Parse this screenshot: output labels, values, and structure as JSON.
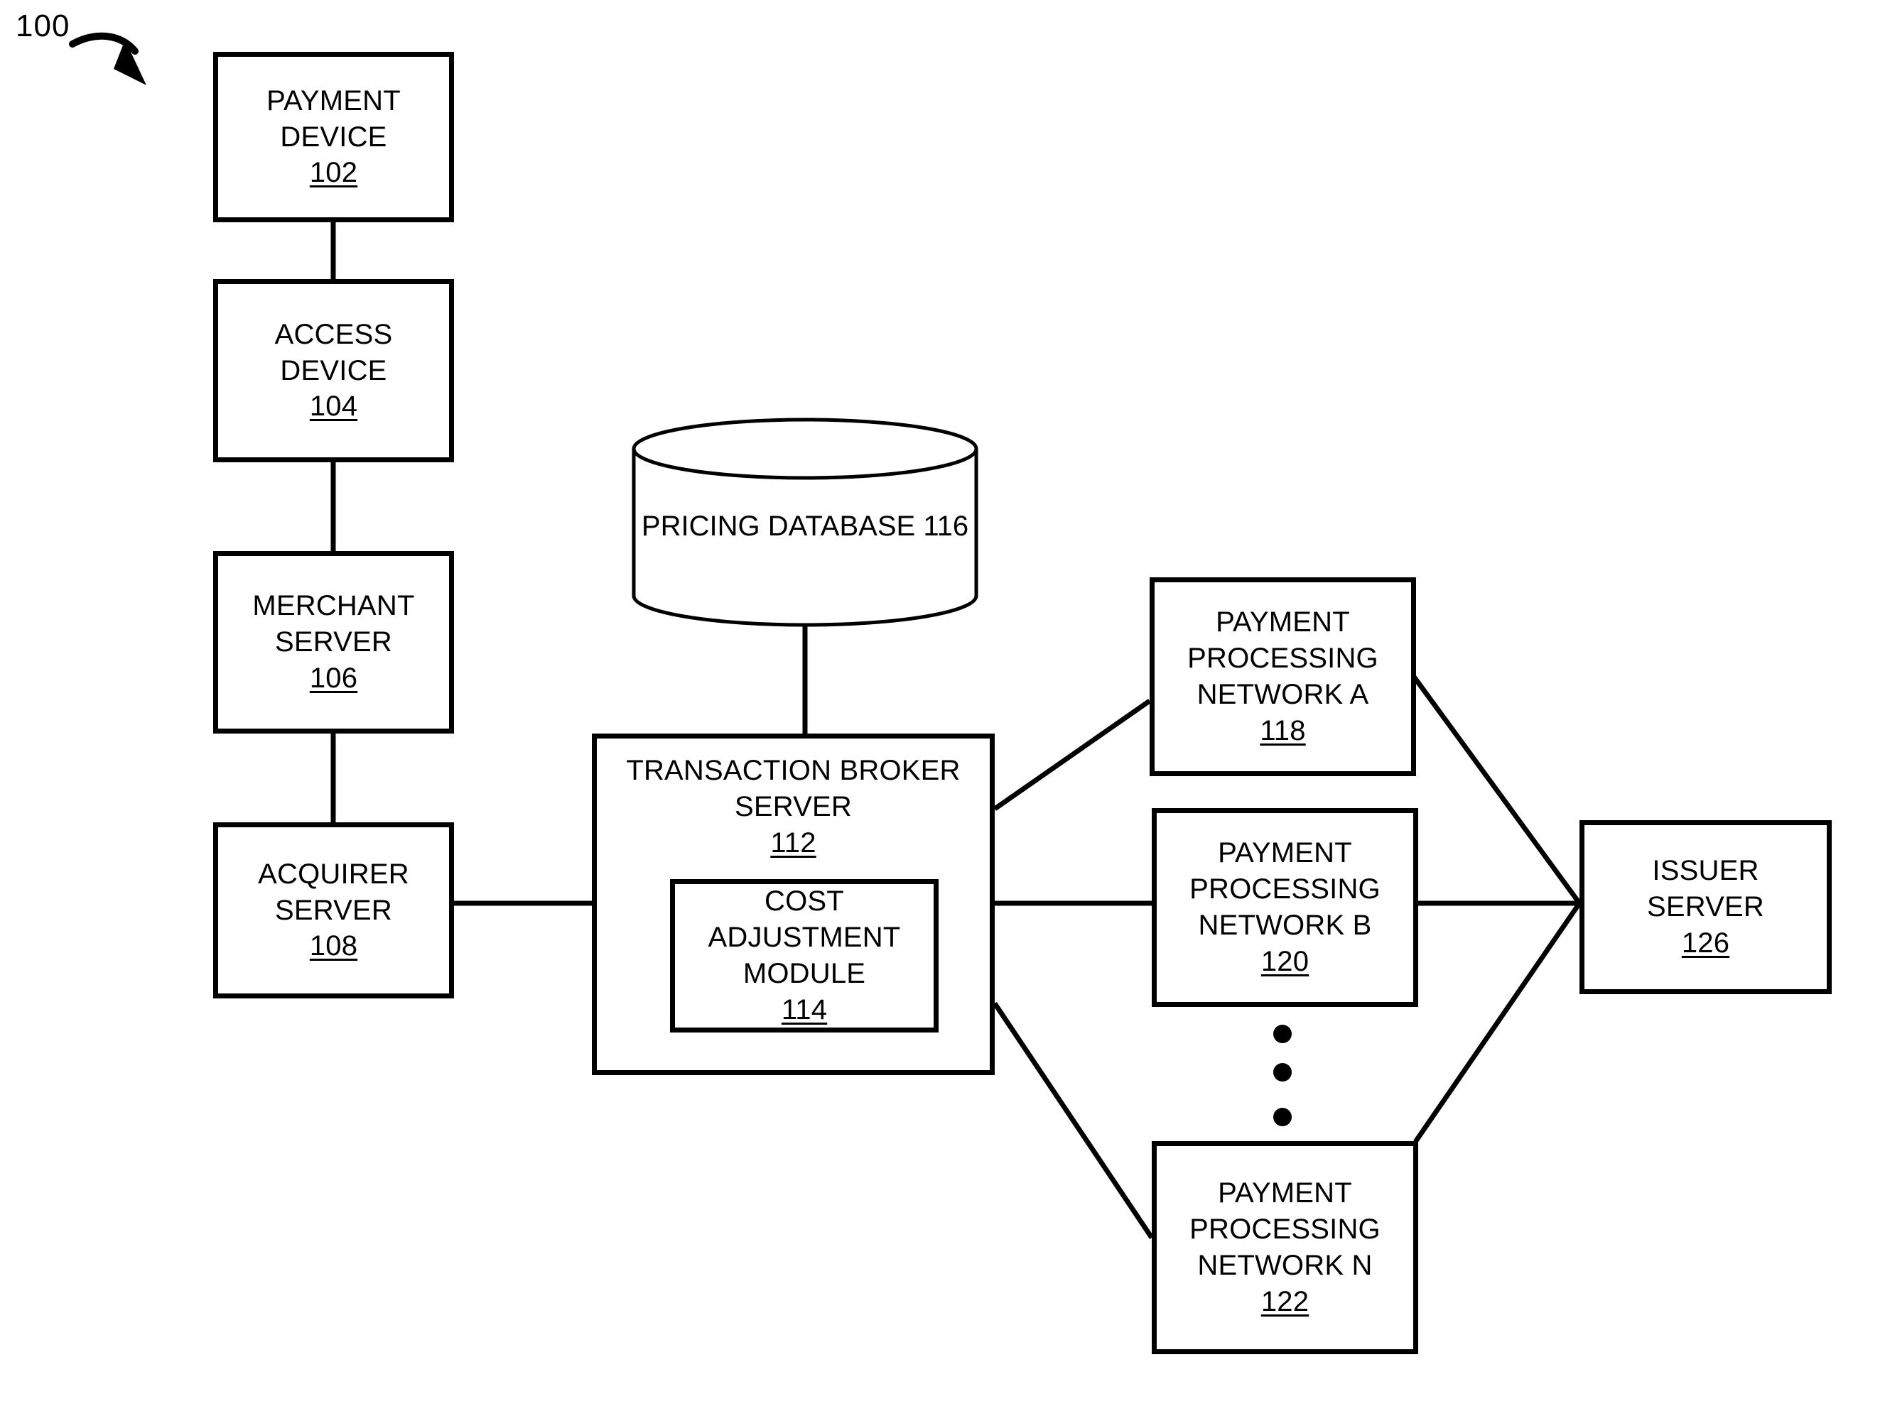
{
  "figure": {
    "number": "100",
    "caption_arrow": "curved-arrow-pointing-to-diagram"
  },
  "nodes": {
    "payment_device": {
      "line1": "PAYMENT",
      "line2": "DEVICE",
      "ref": "102"
    },
    "access_device": {
      "line1": "ACCESS",
      "line2": "DEVICE",
      "ref": "104"
    },
    "merchant_server": {
      "line1": "MERCHANT",
      "line2": "SERVER",
      "ref": "106"
    },
    "acquirer_server": {
      "line1": "ACQUIRER",
      "line2": "SERVER",
      "ref": "108"
    },
    "pricing_database": {
      "line1": "PRICING",
      "line2": "DATABASE",
      "ref": "116"
    },
    "broker_server": {
      "line1": "TRANSACTION BROKER",
      "line2": "SERVER",
      "ref": "112"
    },
    "cost_module": {
      "line1": "COST",
      "line2": "ADJUSTMENT",
      "line3": "MODULE",
      "ref": "114"
    },
    "network_a": {
      "line1": "PAYMENT",
      "line2": "PROCESSING",
      "line3": "NETWORK A",
      "ref": "118"
    },
    "network_b": {
      "line1": "PAYMENT",
      "line2": "PROCESSING",
      "line3": "NETWORK B",
      "ref": "120"
    },
    "network_n": {
      "line1": "PAYMENT",
      "line2": "PROCESSING",
      "line3": "NETWORK N",
      "ref": "122"
    },
    "issuer_server": {
      "line1": "ISSUER",
      "line2": "SERVER",
      "ref": "126"
    }
  },
  "ellipsis": {
    "label": "vertical-ellipsis-between-network-b-and-network-n",
    "count": 3
  },
  "colors": {
    "stroke": "#000000",
    "fill": "#ffffff",
    "text": "#000000"
  },
  "connections": [
    {
      "from": "payment_device",
      "to": "access_device",
      "style": "vertical"
    },
    {
      "from": "access_device",
      "to": "merchant_server",
      "style": "vertical"
    },
    {
      "from": "merchant_server",
      "to": "acquirer_server",
      "style": "vertical"
    },
    {
      "from": "acquirer_server",
      "to": "broker_server",
      "style": "horizontal"
    },
    {
      "from": "pricing_database",
      "to": "broker_server",
      "style": "vertical"
    },
    {
      "from": "broker_server",
      "to": "network_a",
      "style": "diagonal-up"
    },
    {
      "from": "broker_server",
      "to": "network_b",
      "style": "horizontal"
    },
    {
      "from": "broker_server",
      "to": "network_n",
      "style": "diagonal-down"
    },
    {
      "from": "network_a",
      "to": "issuer_server",
      "style": "diagonal-down"
    },
    {
      "from": "network_b",
      "to": "issuer_server",
      "style": "horizontal"
    },
    {
      "from": "network_n",
      "to": "issuer_server",
      "style": "diagonal-up"
    }
  ]
}
